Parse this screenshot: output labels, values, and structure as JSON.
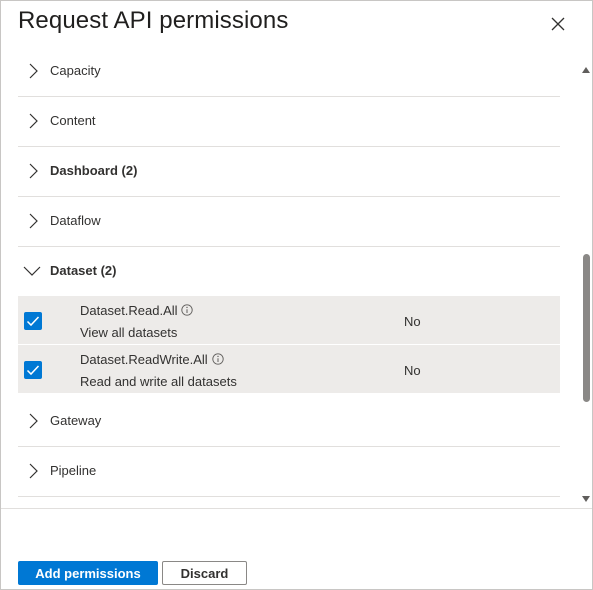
{
  "dialog": {
    "title": "Request API permissions"
  },
  "categories": [
    {
      "label": "Capacity",
      "expanded": false,
      "bold": false
    },
    {
      "label": "Content",
      "expanded": false,
      "bold": false
    },
    {
      "label": "Dashboard (2)",
      "expanded": false,
      "bold": true
    },
    {
      "label": "Dataflow",
      "expanded": false,
      "bold": false
    },
    {
      "label": "Dataset (2)",
      "expanded": true,
      "bold": true
    },
    {
      "label": "Gateway",
      "expanded": false,
      "bold": false
    },
    {
      "label": "Pipeline",
      "expanded": false,
      "bold": false
    }
  ],
  "permissions": [
    {
      "name": "Dataset.Read.All",
      "description": "View all datasets",
      "admin_consent": "No",
      "checked": true
    },
    {
      "name": "Dataset.ReadWrite.All",
      "description": "Read and write all datasets",
      "admin_consent": "No",
      "checked": true
    }
  ],
  "footer": {
    "add_label": "Add permissions",
    "discard_label": "Discard"
  },
  "colors": {
    "accent": "#0078d4",
    "permission_row_bg": "#edebe9"
  },
  "icons": {
    "close": "close-icon",
    "collapsed": "chevron-right-icon",
    "expanded": "chevron-down-icon",
    "info": "info-icon",
    "check": "checkmark-icon"
  }
}
